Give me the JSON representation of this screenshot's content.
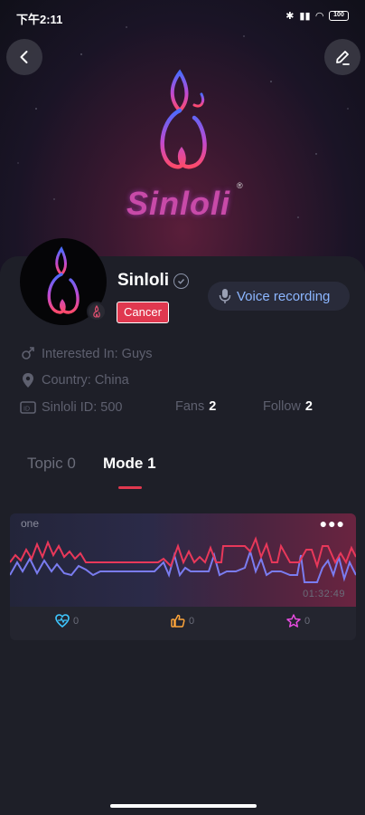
{
  "status_bar": {
    "time": "下午2:11",
    "battery": "100"
  },
  "brand": {
    "name": "Sinloli",
    "reg": "®"
  },
  "profile": {
    "name": "Sinloli",
    "tag": "Cancer",
    "voice_label": "Voice recording",
    "interested_in": "Interested In: Guys",
    "country": "Country: China",
    "id": "Sinloli ID: 500",
    "fans_label": "Fans",
    "fans_count": "2",
    "follow_label": "Follow",
    "follow_count": "2"
  },
  "tabs": [
    {
      "label": "Topic 0",
      "active": false
    },
    {
      "label": "Mode 1",
      "active": true
    }
  ],
  "mode_card": {
    "title": "one",
    "duration": "01:32:49",
    "actions": [
      {
        "icon": "heart-pulse-icon",
        "count": "0",
        "color": "#3ec7ff"
      },
      {
        "icon": "thumbs-up-icon",
        "count": "0",
        "color": "#ffa53a"
      },
      {
        "icon": "star-icon",
        "count": "0",
        "color": "#e84ce0"
      }
    ]
  },
  "colors": {
    "accent": "#e0384f",
    "voice": "#8cb6ff",
    "wave_red": "#e8385a",
    "wave_blue": "#7a7cf0"
  }
}
